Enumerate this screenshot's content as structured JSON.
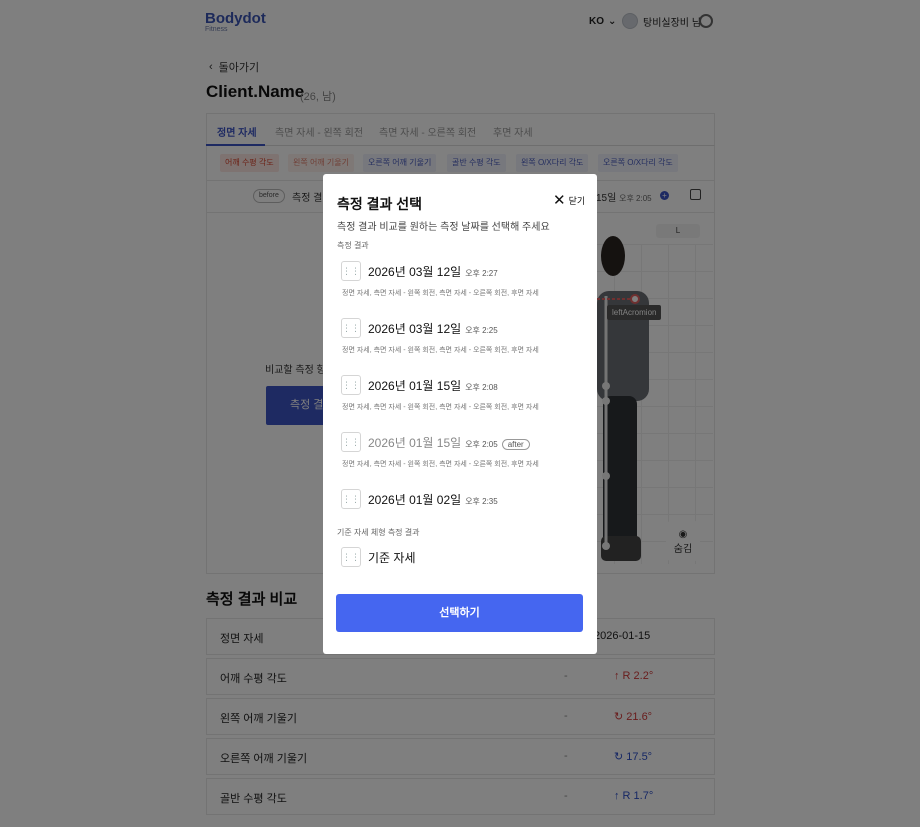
{
  "header": {
    "logo": "Bodydot",
    "logo_sub": "Fitness",
    "lang": "KO",
    "user_name": "탕비실장비 님"
  },
  "nav": {
    "back": "돌아가기"
  },
  "client": {
    "name": "Client.Name",
    "meta": "(26, 남)"
  },
  "tabs": [
    "정면 자세",
    "측면 자세 - 왼쪽 회전",
    "측면 자세 - 오른쪽 회전",
    "후면 자세"
  ],
  "chips": [
    "어깨 수평 각도",
    "왼쪽 어깨 기울기",
    "오른쪽 어깨 기울기",
    "골반 수평 각도",
    "왼쪽 O/X다리 각도",
    "오른쪽 O/X다리 각도"
  ],
  "viewer": {
    "before": "before",
    "before_text": "측정 결",
    "date_right": "15일",
    "time_right": "오후 2:05",
    "side_label": "L",
    "marker_label": "leftAcromion",
    "hide_label": "숨김",
    "compare_prompt": "비교할 측정 항",
    "compare_button": "측정 결"
  },
  "comparison": {
    "title": "측정 결과 비교",
    "header": {
      "label": "정면 자세",
      "value": "2026-01-15"
    },
    "rows": [
      {
        "label": "어깨 수평 각도",
        "mid": "-",
        "value": "↑ R 2.2°",
        "color": "#d23b3b"
      },
      {
        "label": "왼쪽 어깨 기울기",
        "mid": "-",
        "value": "↻ 21.6°",
        "color": "#d23b3b"
      },
      {
        "label": "오른쪽 어깨 기울기",
        "mid": "-",
        "value": "↻ 17.5°",
        "color": "#2c4fc9"
      },
      {
        "label": "골반 수평 각도",
        "mid": "-",
        "value": "↑ R 1.7°",
        "color": "#2c4fc9"
      }
    ]
  },
  "modal": {
    "title": "측정 결과 선택",
    "close": "닫기",
    "subtitle": "측정 결과 비교를 원하는 측정 날짜를 선택해 주세요",
    "section_results": "측정 결과",
    "items": [
      {
        "date": "2026년 03월 12일",
        "time": "오후 2:27",
        "cats": "정면 자세, 측면 자세 - 왼쪽 회전, 측면 자세 - 오른쪽 회전, 후면 자세"
      },
      {
        "date": "2026년 03월 12일",
        "time": "오후 2:25",
        "cats": "정면 자세, 측면 자세 - 왼쪽 회전, 측면 자세 - 오른쪽 회전, 후면 자세"
      },
      {
        "date": "2026년 01월 15일",
        "time": "오후 2:08",
        "cats": "정면 자세, 측면 자세 - 왼쪽 회전, 측면 자세 - 오른쪽 회전, 후면 자세"
      },
      {
        "date": "2026년 01월 15일",
        "time": "오후 2:05",
        "badge": "after",
        "cats": "정면 자세, 측면 자세 - 왼쪽 회전, 측면 자세 - 오른쪽 회전, 후면 자세"
      },
      {
        "date": "2026년 01월 02일",
        "time": "오후 2:35"
      }
    ],
    "section_baseline": "기준 자세 체형 측정 결과",
    "baseline": "기준 자세",
    "button": "선택하기"
  },
  "colors": {
    "accent": "#3d54c4",
    "button": "#4566f0",
    "chip_red_bg": "#fde6e2",
    "chip_red_text": "#d8452e"
  }
}
